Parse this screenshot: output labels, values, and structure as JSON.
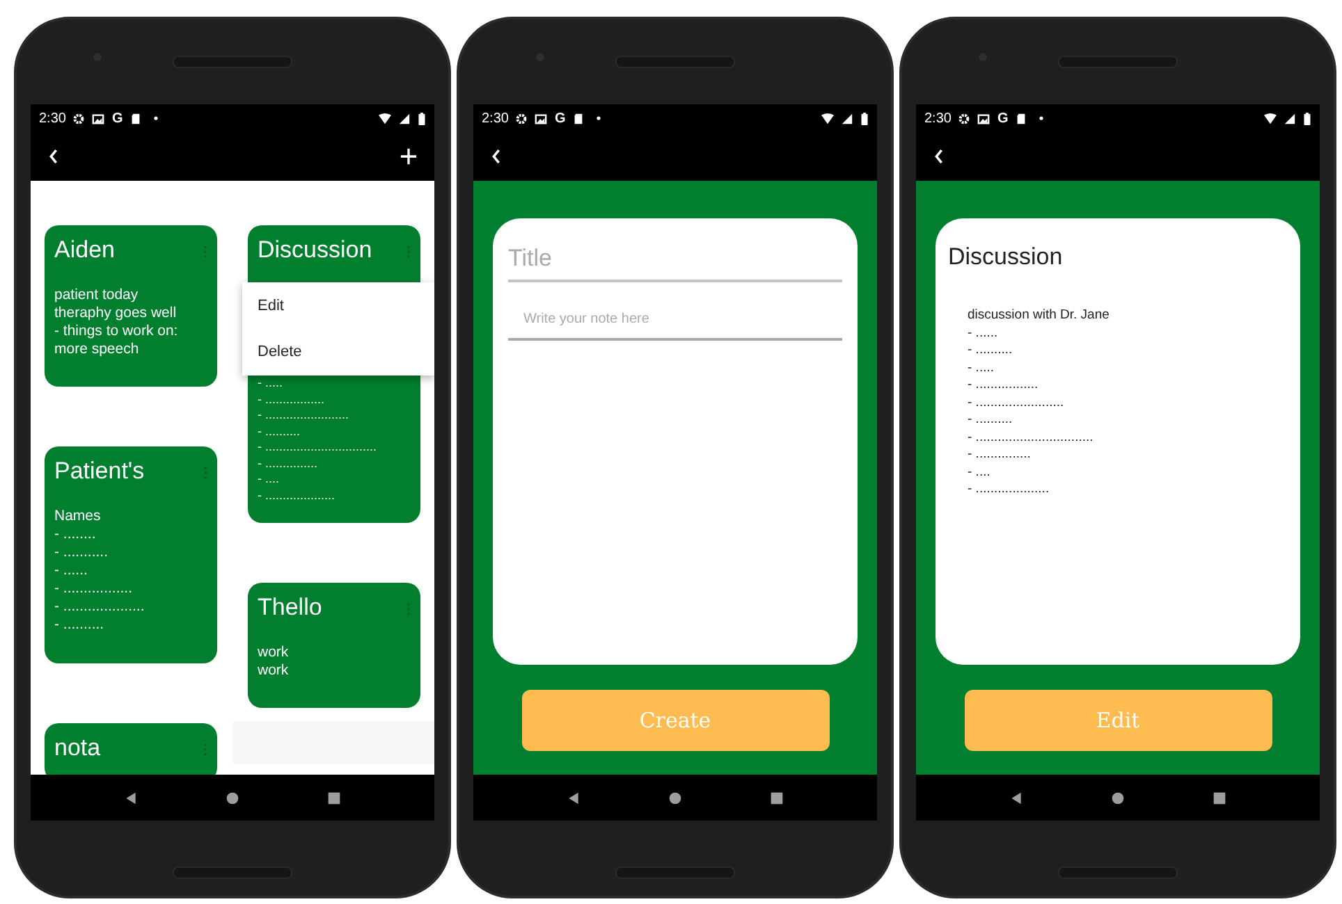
{
  "screens": [
    {
      "kind": "notes_list",
      "status_bar": {
        "time": "2:30",
        "badge": "G"
      },
      "app_bar": {
        "back": true,
        "add": true
      },
      "columns": [
        [
          {
            "title": "Aiden",
            "body": "patient today\ntheraphy goes well\n- things to work on:\nmore speech"
          },
          {
            "title": "Patient's",
            "body": "Names\n- ........\n- ...........\n- ......\n- .................\n- ....................\n- .........."
          },
          {
            "title": "nota"
          }
        ],
        [
          {
            "title": "Discussion",
            "body": "- .....\n- .................\n- ........................\n- ..........\n- ................................\n- ...............\n- ....\n- ....................",
            "menu": [
              "Edit",
              "Delete"
            ]
          },
          {
            "title": "Thello",
            "body": "work\nwork"
          }
        ]
      ]
    },
    {
      "kind": "note_editor",
      "status_bar": {
        "time": "2:30",
        "badge": "G"
      },
      "app_bar": {
        "back": true
      },
      "title_field": {
        "placeholder": "Title"
      },
      "note_field": {
        "placeholder": "Write your note here"
      },
      "button": "Create"
    },
    {
      "kind": "note_view",
      "status_bar": {
        "time": "2:30",
        "badge": "G"
      },
      "app_bar": {
        "back": true
      },
      "title": "Discussion",
      "body": "discussion with Dr. Jane\n- ......\n- ..........\n- .....\n- .................\n- ........................\n- ..........\n- ................................\n- ...............\n- ....\n- ....................",
      "button": "Edit"
    }
  ]
}
